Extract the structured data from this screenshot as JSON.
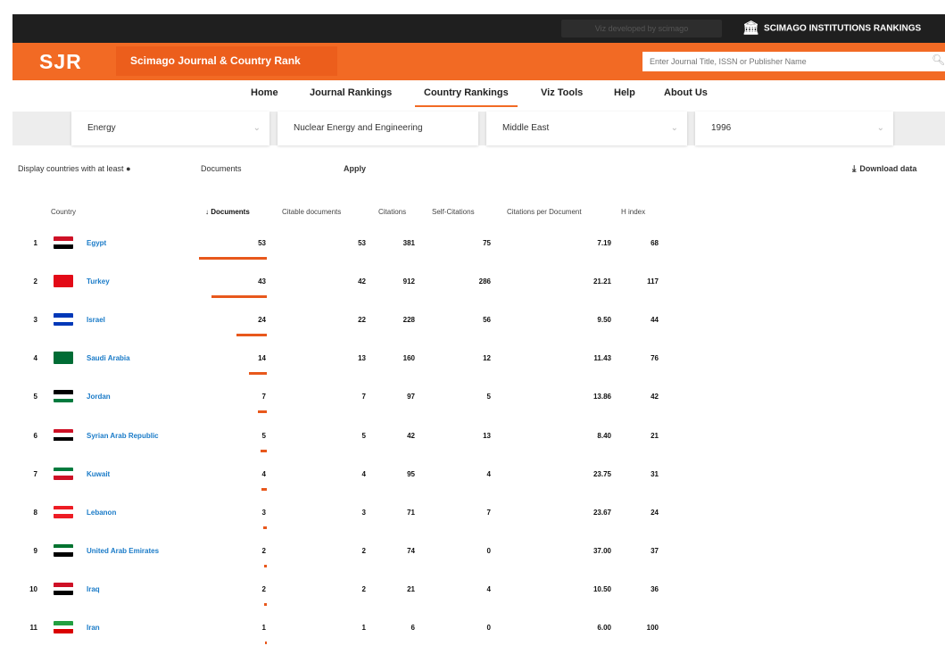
{
  "topbar": {
    "developer_text": "Viz developed by scimago",
    "institutions": "SCIMAGO INSTITUTIONS RANKINGS",
    "icon": "institution-icon"
  },
  "header": {
    "logo": "SJR",
    "brand": "Scimago Journal & Country Rank",
    "search_placeholder": "Enter Journal Title, ISSN or Publisher Name"
  },
  "nav": {
    "items": [
      "Home",
      "Journal Rankings",
      "Country Rankings",
      "Viz Tools",
      "Help",
      "About Us"
    ],
    "active": "Country Rankings"
  },
  "filters": {
    "subject_area": "Energy",
    "subject_category": "Nuclear Energy and Engineering",
    "region": "Middle East",
    "year": "1996"
  },
  "options": {
    "display_label": "Display countries with at least",
    "documents_label": "Documents",
    "apply_label": "Apply",
    "download_label": "Download data"
  },
  "colors": {
    "accent": "#f26a24",
    "link": "#1a7bc8",
    "topbar": "#1f1f1f"
  },
  "table": {
    "headers": [
      "Country",
      "Documents",
      "Citable documents",
      "Citations",
      "Self-Citations",
      "Citations per Document",
      "H index"
    ],
    "sorted_column": "Documents",
    "rows": [
      {
        "rank": "1",
        "country": "Egypt",
        "documents": "53",
        "citable": "53",
        "citations": "381",
        "self_citations": "75",
        "cpd": "7.19",
        "h_index": "68",
        "flag": [
          "#ce1126",
          "#ffffff",
          "#000000"
        ]
      },
      {
        "rank": "2",
        "country": "Turkey",
        "documents": "43",
        "citable": "42",
        "citations": "912",
        "self_citations": "286",
        "cpd": "21.21",
        "h_index": "117",
        "flag": [
          "#e30a17",
          "#e30a17",
          "#e30a17"
        ]
      },
      {
        "rank": "3",
        "country": "Israel",
        "documents": "24",
        "citable": "22",
        "citations": "228",
        "self_citations": "56",
        "cpd": "9.50",
        "h_index": "44",
        "flag": [
          "#0038b8",
          "#ffffff",
          "#0038b8"
        ]
      },
      {
        "rank": "4",
        "country": "Saudi Arabia",
        "documents": "14",
        "citable": "13",
        "citations": "160",
        "self_citations": "12",
        "cpd": "11.43",
        "h_index": "76",
        "flag": [
          "#006c35",
          "#006c35",
          "#006c35"
        ]
      },
      {
        "rank": "5",
        "country": "Jordan",
        "documents": "7",
        "citable": "7",
        "citations": "97",
        "self_citations": "5",
        "cpd": "13.86",
        "h_index": "42",
        "flag": [
          "#000000",
          "#ffffff",
          "#007a3d"
        ]
      },
      {
        "rank": "6",
        "country": "Syrian Arab Republic",
        "documents": "5",
        "citable": "5",
        "citations": "42",
        "self_citations": "13",
        "cpd": "8.40",
        "h_index": "21",
        "flag": [
          "#ce1126",
          "#ffffff",
          "#000000"
        ]
      },
      {
        "rank": "7",
        "country": "Kuwait",
        "documents": "4",
        "citable": "4",
        "citations": "95",
        "self_citations": "4",
        "cpd": "23.75",
        "h_index": "31",
        "flag": [
          "#007a3d",
          "#ffffff",
          "#ce1126"
        ]
      },
      {
        "rank": "8",
        "country": "Lebanon",
        "documents": "3",
        "citable": "3",
        "citations": "71",
        "self_citations": "7",
        "cpd": "23.67",
        "h_index": "24",
        "flag": [
          "#ed1c24",
          "#ffffff",
          "#ed1c24"
        ]
      },
      {
        "rank": "9",
        "country": "United Arab Emirates",
        "documents": "2",
        "citable": "2",
        "citations": "74",
        "self_citations": "0",
        "cpd": "37.00",
        "h_index": "37",
        "flag": [
          "#00732f",
          "#ffffff",
          "#000000"
        ]
      },
      {
        "rank": "10",
        "country": "Iraq",
        "documents": "2",
        "citable": "2",
        "citations": "21",
        "self_citations": "4",
        "cpd": "10.50",
        "h_index": "36",
        "flag": [
          "#ce1126",
          "#ffffff",
          "#000000"
        ]
      },
      {
        "rank": "11",
        "country": "Iran",
        "documents": "1",
        "citable": "1",
        "citations": "6",
        "self_citations": "0",
        "cpd": "6.00",
        "h_index": "100",
        "flag": [
          "#239f40",
          "#ffffff",
          "#da0000"
        ]
      }
    ]
  }
}
